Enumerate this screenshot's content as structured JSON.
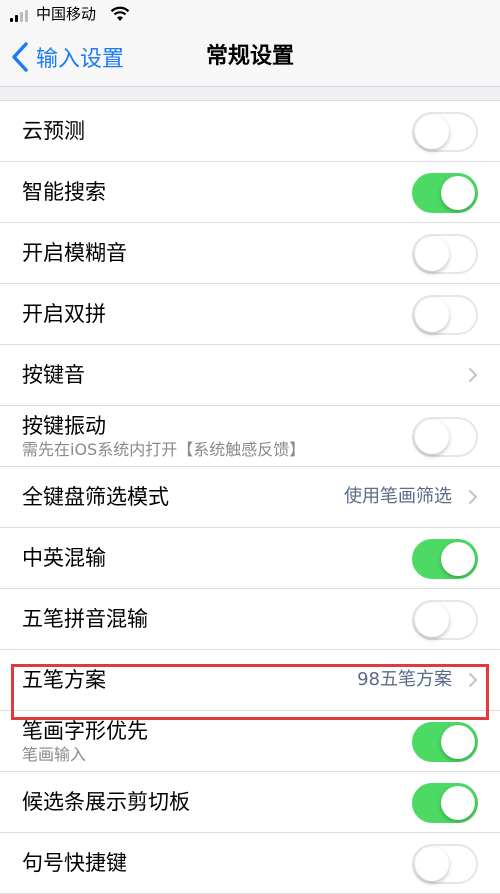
{
  "status_bar": {
    "carrier": "中国移动"
  },
  "nav": {
    "back_label": "输入设置",
    "title": "常规设置"
  },
  "rows": [
    {
      "label": "云预测",
      "control": "toggle",
      "on": false
    },
    {
      "label": "智能搜索",
      "control": "toggle",
      "on": true
    },
    {
      "label": "开启模糊音",
      "control": "toggle",
      "on": false
    },
    {
      "label": "开启双拼",
      "control": "toggle",
      "on": false
    },
    {
      "label": "按键音",
      "control": "chevron"
    },
    {
      "label": "按键振动",
      "subtitle": "需先在iOS系统内打开【系统触感反馈】",
      "control": "toggle",
      "on": false
    },
    {
      "label": "全键盘筛选模式",
      "value": "使用笔画筛选",
      "control": "chevron"
    },
    {
      "label": "中英混输",
      "control": "toggle",
      "on": true
    },
    {
      "label": "五笔拼音混输",
      "control": "toggle",
      "on": false
    },
    {
      "label": "五笔方案",
      "value": "98五笔方案",
      "control": "chevron"
    },
    {
      "label": "笔画字形优先",
      "subtitle": "笔画输入",
      "control": "toggle",
      "on": true
    },
    {
      "label": "候选条展示剪切板",
      "control": "toggle",
      "on": true
    },
    {
      "label": "句号快捷键",
      "control": "toggle",
      "on": false
    }
  ],
  "colors": {
    "accent": "#1a7cf5",
    "toggle_on": "#4cd964",
    "highlight": "#e23a3a"
  }
}
